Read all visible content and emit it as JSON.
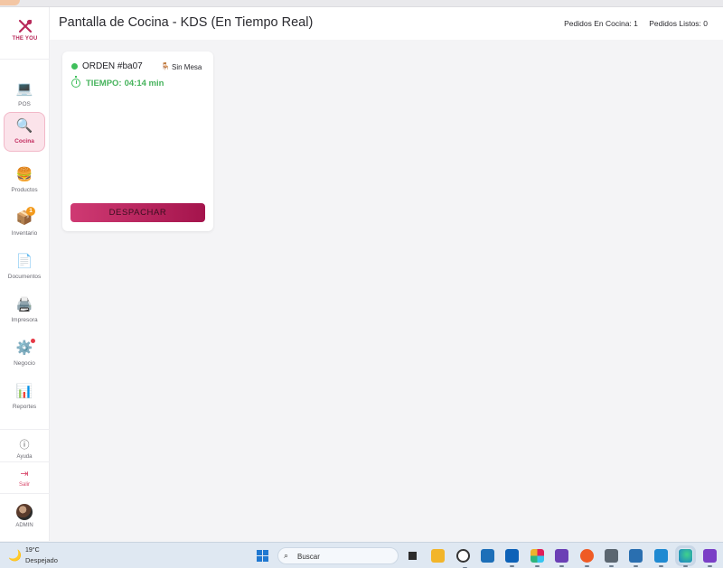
{
  "brand": {
    "name": "THE YOU",
    "accent": "#b8295a"
  },
  "sidebar": {
    "items": [
      {
        "label": "POS",
        "icon": "laptop-icon"
      },
      {
        "label": "Cocina",
        "icon": "magnifier-icon",
        "active": true
      },
      {
        "label": "Productos",
        "icon": "burger-icon"
      },
      {
        "label": "Inventario",
        "icon": "package-icon",
        "badge": "1"
      },
      {
        "label": "Documentos",
        "icon": "document-icon"
      },
      {
        "label": "Impresora",
        "icon": "printer-icon"
      },
      {
        "label": "Negocio",
        "icon": "gear-icon"
      },
      {
        "label": "Reportes",
        "icon": "bar-chart-icon"
      }
    ],
    "help_label": "Ayuda",
    "logout_label": "Salir",
    "user_label": "ADMIN"
  },
  "header": {
    "title": "Pantalla de Cocina - KDS (En Tiempo Real)",
    "kitchen_orders": "Pedidos En Cocina: 1",
    "ready_orders": "Pedidos Listos: 0"
  },
  "orders": [
    {
      "id": "ORDEN #ba07",
      "table": "Sin Mesa",
      "timer_label": "TIEMPO:",
      "timer_value": "04:14 min",
      "status_color": "#3fbf5b",
      "action_label": "DESPACHAR"
    }
  ],
  "taskbar": {
    "weather_temp": "19°C",
    "weather_desc": "Despejado",
    "search_placeholder": "Buscar",
    "apps": [
      "file-explorer-icon",
      "files-folder-icon",
      "panda-icon",
      "store-icon",
      "outlook-icon",
      "slack-icon",
      "visual-studio-icon",
      "postman-icon",
      "calculator-icon",
      "database-icon",
      "vscode-icon",
      "edge-icon",
      "visual-studio-purple-icon"
    ]
  }
}
